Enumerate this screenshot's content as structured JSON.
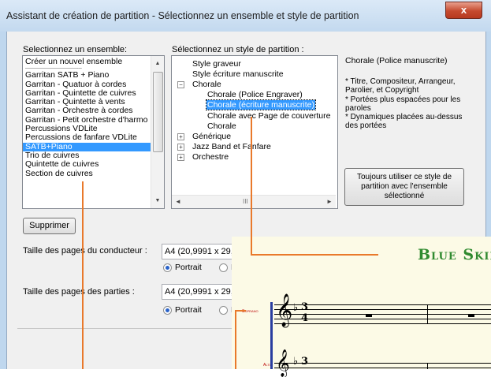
{
  "window": {
    "title": "Assistant de création de partition - Sélectionnez un ensemble et style de partition",
    "close_glyph": "x"
  },
  "ensemble": {
    "label": "Selectionnez un ensemble:",
    "items": [
      "Créer un nouvel ensemble",
      "------------------------------------",
      "Garritan SATB + Piano",
      "Garritan - Quatuor à cordes",
      "Garritan - Quintette de cuivres",
      "Garritan - Quintette à vents",
      "Garritan - Orchestre à cordes",
      "Garritan - Petit orchestre d'harmo",
      "Percussions VDLite",
      "Percussions de fanfare VDLite",
      "SATB+Piano",
      "Trio de cuivres",
      "Quintette de cuivres",
      "Section de cuivres"
    ],
    "selected": "SATB+Piano",
    "delete_button": "Supprimer"
  },
  "style": {
    "label": "Sélectionnez un style de partition :",
    "tree": {
      "style_graveur": "Style graveur",
      "style_manuscrite": "Style écriture manuscrite",
      "chorale": "Chorale",
      "chorale_engraver": "Chorale (Police Engraver)",
      "chorale_manuscrite": "Chorale (écriture manuscrite)",
      "chorale_page": "Chorale avec Page de couverture",
      "chorale_plain": "Chorale",
      "generique": "Générique",
      "jazz": "Jazz Band et Fanfare",
      "orchestre": "Orchestre"
    },
    "expand_minus": "−",
    "expand_plus": "+",
    "hscroll_thumb": "III"
  },
  "description": {
    "title": "Chorale (Police manuscrite)",
    "lines": [
      "* Titre, Compositeur, Arrangeur,",
      "Parolier, et Copyright",
      "* Portées plus espacées pour les",
      "paroles",
      "* Dynamiques placées au-dessus",
      "des portées"
    ],
    "always_button": [
      "Toujours utiliser ce style de",
      "partition avec l'ensemble",
      "sélectionné"
    ]
  },
  "page_size": {
    "conductor_label": "Taille des pages du conducteur :",
    "conductor_value": "A4 (20,9991 x 29,",
    "parts_label": "Taille des pages des parties :",
    "parts_value": "A4 (20,9991 x 29,",
    "portrait": "Portrait",
    "landscape_partial": "P"
  },
  "score_preview": {
    "title": "Blue Skies",
    "soprano_label": "Soprano",
    "alto_label": "Alto",
    "time_signature": [
      "3",
      "4"
    ]
  },
  "colors": {
    "accent": "#e9792b",
    "selection": "#3399ff",
    "score_title": "#2f8a2f"
  }
}
